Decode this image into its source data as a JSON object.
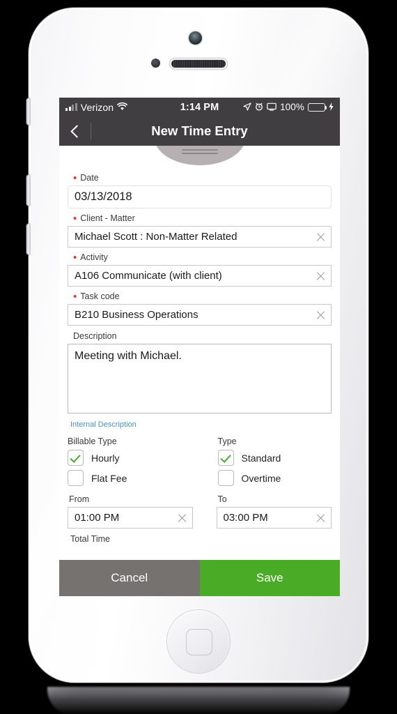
{
  "status_bar": {
    "carrier": "Verizon",
    "wifi_icon": "wifi-icon",
    "time": "1:14 PM",
    "location_icon": "location-arrow-icon",
    "alarm_icon": "alarm-clock-icon",
    "airplay_icon": "screen-mirroring-icon",
    "battery_percent": "100%",
    "charging_icon": "lightning-bolt-icon",
    "battery_color": "#4cd137"
  },
  "nav": {
    "back_icon": "chevron-left-icon",
    "title": "New Time Entry",
    "background_color": "#413e42"
  },
  "form": {
    "date": {
      "label": "Date",
      "required": true,
      "value": "03/13/2018",
      "placeholder": "MM/DD/YYYY"
    },
    "client_matter": {
      "label": "Client - Matter",
      "required": true,
      "value": "Michael Scott : Non-Matter Related",
      "placeholder": "Select client - matter",
      "clear_icon": "clear-x-icon"
    },
    "activity": {
      "label": "Activity",
      "required": true,
      "value": "A106 Communicate (with client)",
      "placeholder": "Select activity",
      "clear_icon": "clear-x-icon"
    },
    "task_code": {
      "label": "Task code",
      "required": true,
      "value": "B210 Business Operations",
      "placeholder": "Select task code",
      "clear_icon": "clear-x-icon"
    },
    "description": {
      "label": "Description",
      "value": "Meeting with Michael.",
      "placeholder": "Enter description"
    },
    "internal_description_link": "Internal Description",
    "billable_type": {
      "label": "Billable Type",
      "options": [
        {
          "label": "Hourly",
          "checked": true
        },
        {
          "label": "Flat Fee",
          "checked": false
        }
      ]
    },
    "type": {
      "label": "Type",
      "options": [
        {
          "label": "Standard",
          "checked": true
        },
        {
          "label": "Overtime",
          "checked": false
        }
      ]
    },
    "from": {
      "label": "From",
      "value": "01:00 PM",
      "placeholder": "hh:mm AM/PM",
      "clear_icon": "clear-x-icon"
    },
    "to": {
      "label": "To",
      "value": "03:00 PM",
      "placeholder": "hh:mm AM/PM",
      "clear_icon": "clear-x-icon"
    },
    "total_time_label": "Total Time"
  },
  "footer": {
    "cancel_label": "Cancel",
    "save_label": "Save",
    "cancel_color": "#76726f",
    "save_color": "#4aab27"
  },
  "device": {
    "camera_icon": "front-camera-icon",
    "sensor_icon": "proximity-sensor-icon",
    "speaker_icon": "earpiece-speaker-icon",
    "home_icon": "home-button-icon"
  }
}
